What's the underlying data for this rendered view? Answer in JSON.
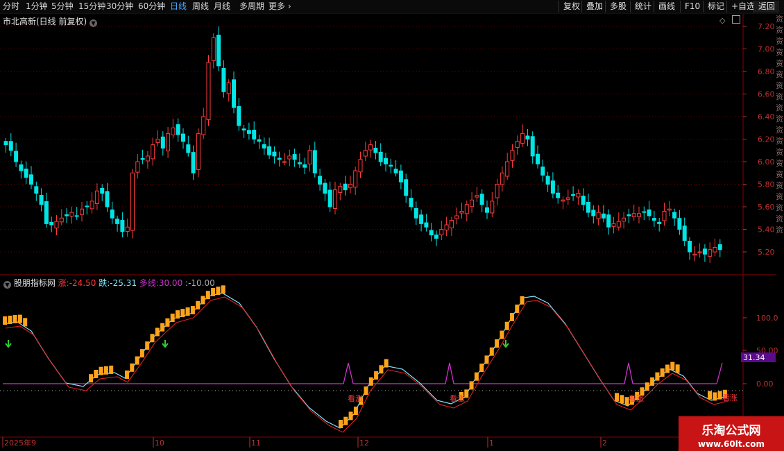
{
  "toolbar": {
    "periods": [
      {
        "label": "分时",
        "active": false
      },
      {
        "label": "1分钟",
        "active": false
      },
      {
        "label": "5分钟",
        "active": false
      },
      {
        "label": "15分钟",
        "active": false
      },
      {
        "label": "30分钟",
        "active": false
      },
      {
        "label": "60分钟",
        "active": false
      },
      {
        "label": "日线",
        "active": true
      },
      {
        "label": "周线",
        "active": false
      },
      {
        "label": "月线",
        "active": false
      },
      {
        "label": "多周期",
        "active": false
      },
      {
        "label": "更多",
        "active": false
      }
    ],
    "right_buttons": [
      "复权",
      "叠加",
      "多股",
      "统计",
      "画线",
      "F10",
      "标记",
      "+自选",
      "返回"
    ]
  },
  "main_panel": {
    "title": "市北高新(日线 前复权)",
    "price_ticks": [
      "7.20",
      "7.00",
      "6.80",
      "6.60",
      "6.40",
      "6.20",
      "6.00",
      "5.80",
      "5.60",
      "5.40",
      "5.20"
    ]
  },
  "indicator_panel": {
    "name": "股朋指标网",
    "zhang_label": "涨:",
    "zhang_value": "-24.50",
    "die_label": "跌:",
    "die_value": "-25.31",
    "duoxian_label": "多线:",
    "duoxian_value": "30.00",
    "extra_value": ":-10.00",
    "ticks": [
      "100.0",
      "50.00",
      "0.00"
    ],
    "current_value": "31.34",
    "signal_label": "看涨"
  },
  "date_axis": {
    "labels": [
      "2025年9",
      "10",
      "11",
      "12",
      "1",
      "2"
    ]
  },
  "right_strip_text": "资资资资资资资资资资资资资资资资资资资资",
  "watermark": {
    "line1": "乐淘公式网",
    "line2": "www.60lt.com"
  },
  "colors": {
    "up": "#ff3b3b",
    "down": "#00e5e5",
    "indicator_bar": "#ffa31a",
    "line_red": "#e02020",
    "line_cyan": "#7fe6ff",
    "line_magenta": "#d030d0",
    "arrow": "#2fd02f",
    "grid": "#6a0000"
  }
}
